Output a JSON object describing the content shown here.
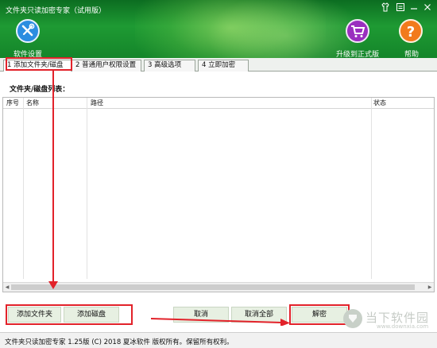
{
  "window": {
    "title": "文件夹只读加密专家（试用版）"
  },
  "toolbar": {
    "settings_label": "软件设置",
    "upgrade_label": "升级到正式版",
    "help_label": "帮助"
  },
  "tabs": [
    {
      "label": "1 添加文件夹/磁盘",
      "active": true
    },
    {
      "label": "2 普通用户权限设置",
      "active": false
    },
    {
      "label": "3 高级选项",
      "active": false
    },
    {
      "label": "4 立即加密",
      "active": false
    }
  ],
  "main": {
    "list_heading": "文件夹/磁盘列表：",
    "columns": [
      "序号",
      "名称",
      "路径",
      "状态"
    ],
    "rows": []
  },
  "buttons": {
    "add_folder": "添加文件夹",
    "add_disk": "添加磁盘",
    "cancel": "取消",
    "cancel_all": "取消全部",
    "decrypt": "解密"
  },
  "status_bar": {
    "text": "文件夹只读加密专家 1.25版 (C) 2018 夏冰软件 版权所有。保留所有权利。"
  },
  "watermark": {
    "text": "当下软件园",
    "url": "www.downxia.com"
  },
  "colors": {
    "header_green": "#1e9a33",
    "annotation_red": "#e2222a",
    "button_green": "#e7f0e2"
  }
}
